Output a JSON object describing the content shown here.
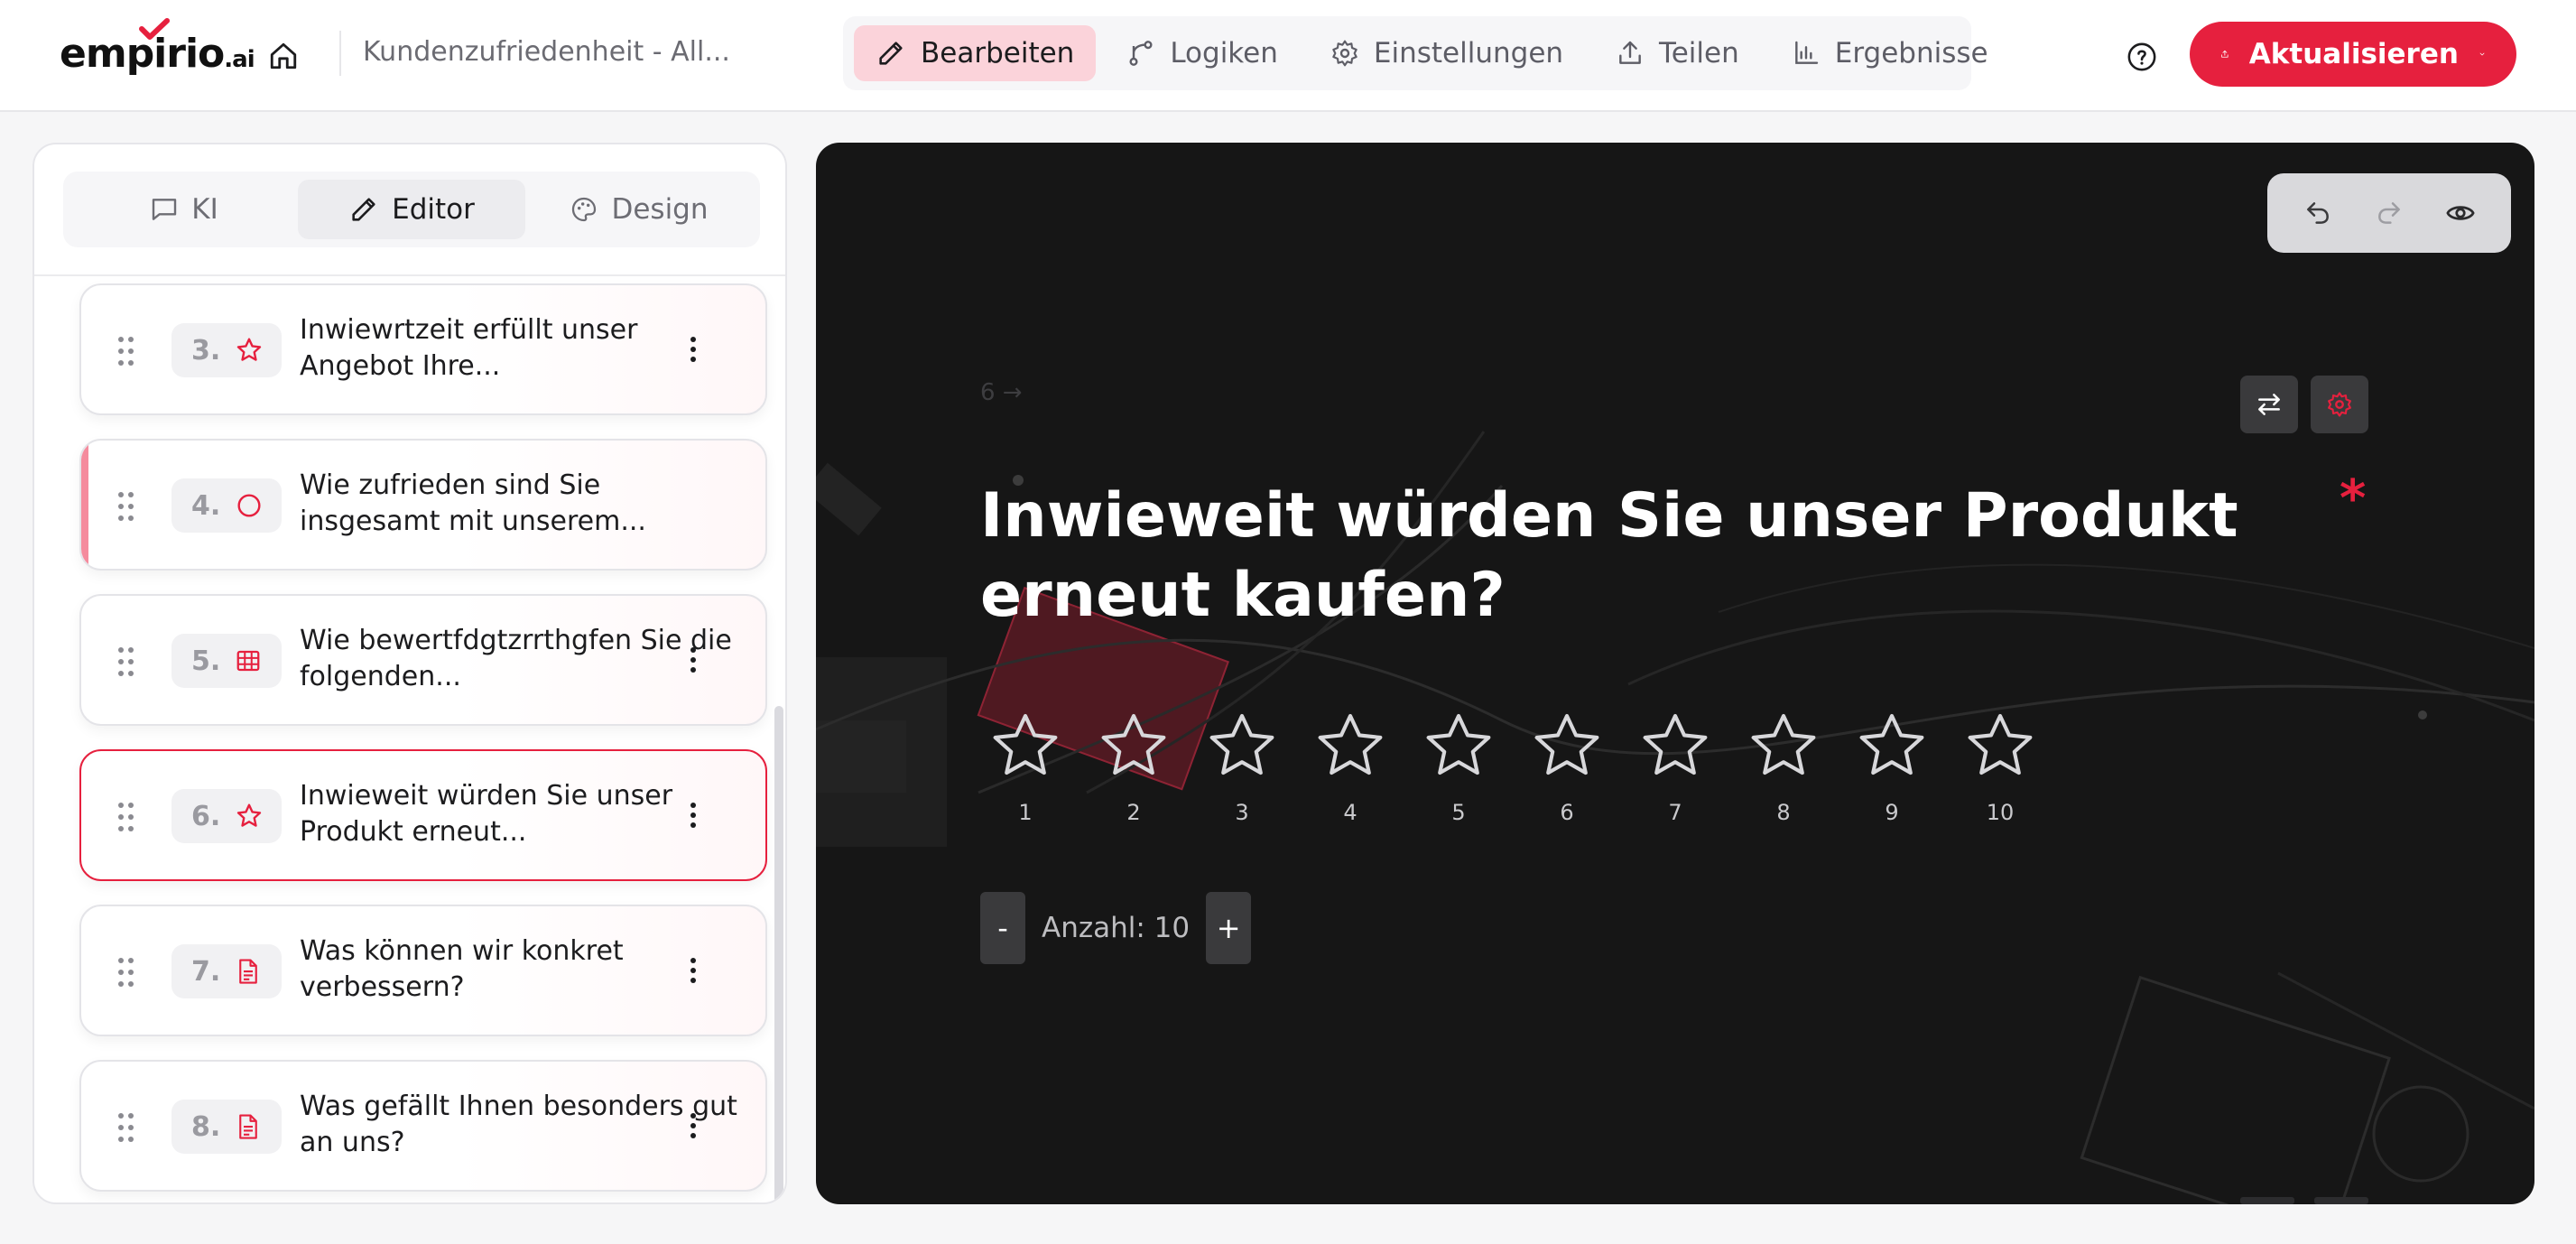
{
  "app": {
    "brand": "empirio",
    "brand_suffix": ".ai",
    "survey_title": "Kundenzufriedenheit - All...",
    "update_label": "Aktualisieren"
  },
  "nav": [
    {
      "label": "Bearbeiten",
      "icon": "pencil-icon",
      "active": true
    },
    {
      "label": "Logiken",
      "icon": "branch-icon",
      "active": false
    },
    {
      "label": "Einstellungen",
      "icon": "gear-icon",
      "active": false
    },
    {
      "label": "Teilen",
      "icon": "upload-icon",
      "active": false
    },
    {
      "label": "Ergebnisse",
      "icon": "bar-chart-icon",
      "active": false
    }
  ],
  "panel_tabs": [
    {
      "label": "KI",
      "icon": "chat-icon",
      "active": false
    },
    {
      "label": "Editor",
      "icon": "pencil-icon",
      "active": true
    },
    {
      "label": "Design",
      "icon": "palette-icon",
      "active": false
    }
  ],
  "questions": [
    {
      "number": "3.",
      "icon": "star-icon",
      "text": "Inwiewrtzeit erfüllt unser Angebot Ihre..."
    },
    {
      "number": "4.",
      "icon": "circle-icon",
      "text": "Wie zufrieden sind Sie insgesamt mit unserem..."
    },
    {
      "number": "5.",
      "icon": "grid-icon",
      "text": "Wie bewertfdgtzrrthgfen Sie die folgenden..."
    },
    {
      "number": "6.",
      "icon": "star-icon",
      "text": "Inwieweit würden Sie unser Produkt erneut..."
    },
    {
      "number": "7.",
      "icon": "document-icon",
      "text": "Was können wir konkret verbessern?"
    },
    {
      "number": "8.",
      "icon": "document-icon",
      "text": "Was gefällt Ihnen besonders gut an uns?"
    }
  ],
  "preview": {
    "question_number": "6 →",
    "question_title": "Inwieweit würden Sie unser Produkt erneut kaufen?",
    "required_mark": "*",
    "star_labels": [
      "1",
      "2",
      "3",
      "4",
      "5",
      "6",
      "7",
      "8",
      "9",
      "10"
    ],
    "count_label": "Anzahl: 10",
    "minus": "-",
    "plus": "+"
  },
  "colors": {
    "accent": "#e6203e",
    "active_nav_bg": "#fbd3da",
    "canvas_bg": "#161616"
  }
}
